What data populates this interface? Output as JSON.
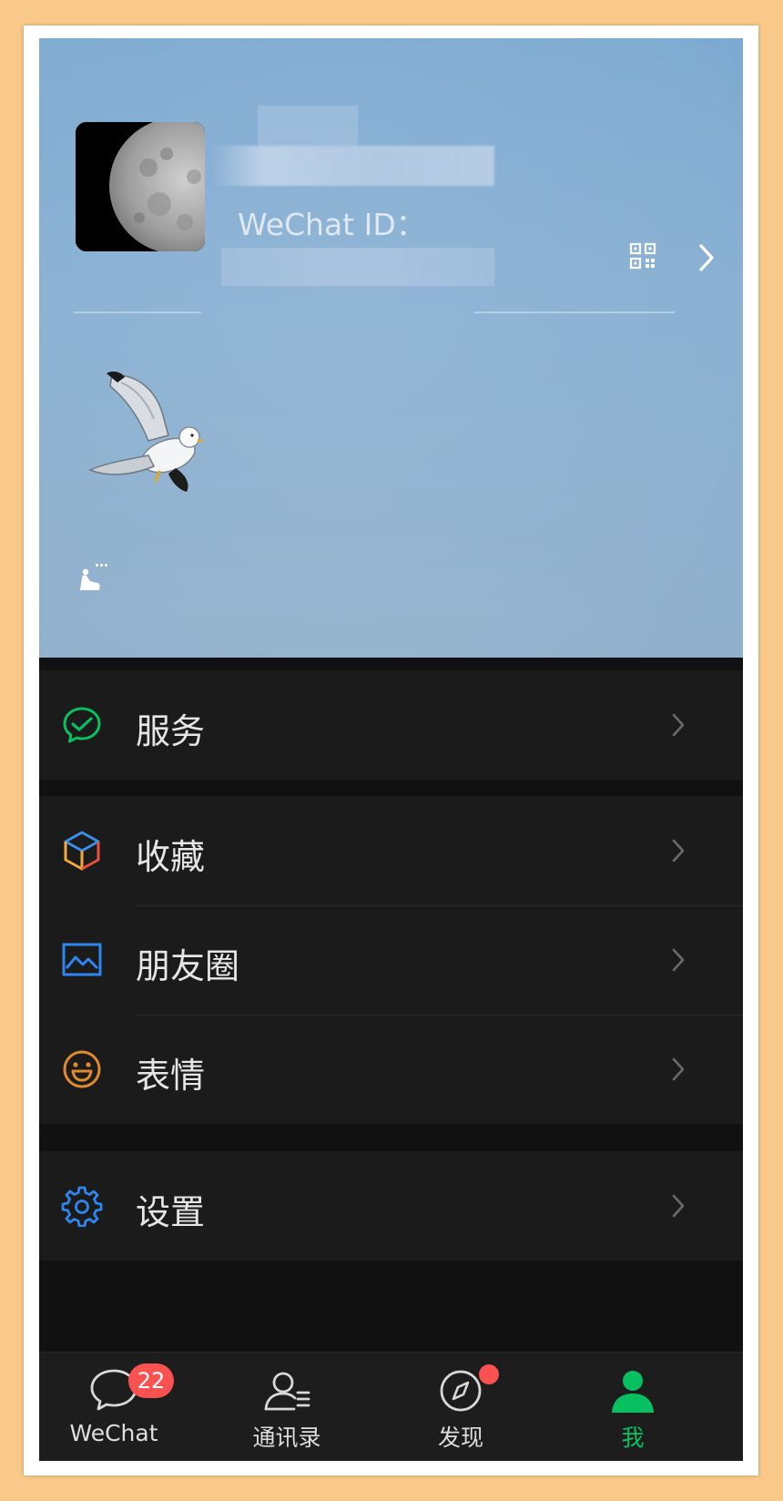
{
  "profile": {
    "wechat_id_label": "WeChat ID："
  },
  "menu": {
    "services": "服务",
    "favorites": "收藏",
    "moments": "朋友圈",
    "stickers": "表情",
    "settings": "设置"
  },
  "tabbar": {
    "chats": "WeChat",
    "chats_badge": "22",
    "contacts": "通讯录",
    "discover": "发现",
    "me": "我"
  },
  "icons": {
    "qr": "qr-code-icon",
    "chevron": "chevron-right-icon",
    "services": "services-icon",
    "favorites": "cube-icon",
    "moments": "picture-icon",
    "stickers": "smiley-icon",
    "settings": "gear-icon"
  },
  "colors": {
    "accent_green": "#07c160",
    "badge_red": "#fa5151",
    "cell_background": "#1b1b1b",
    "page_background": "#111111",
    "header_blue": "#86aed1"
  }
}
